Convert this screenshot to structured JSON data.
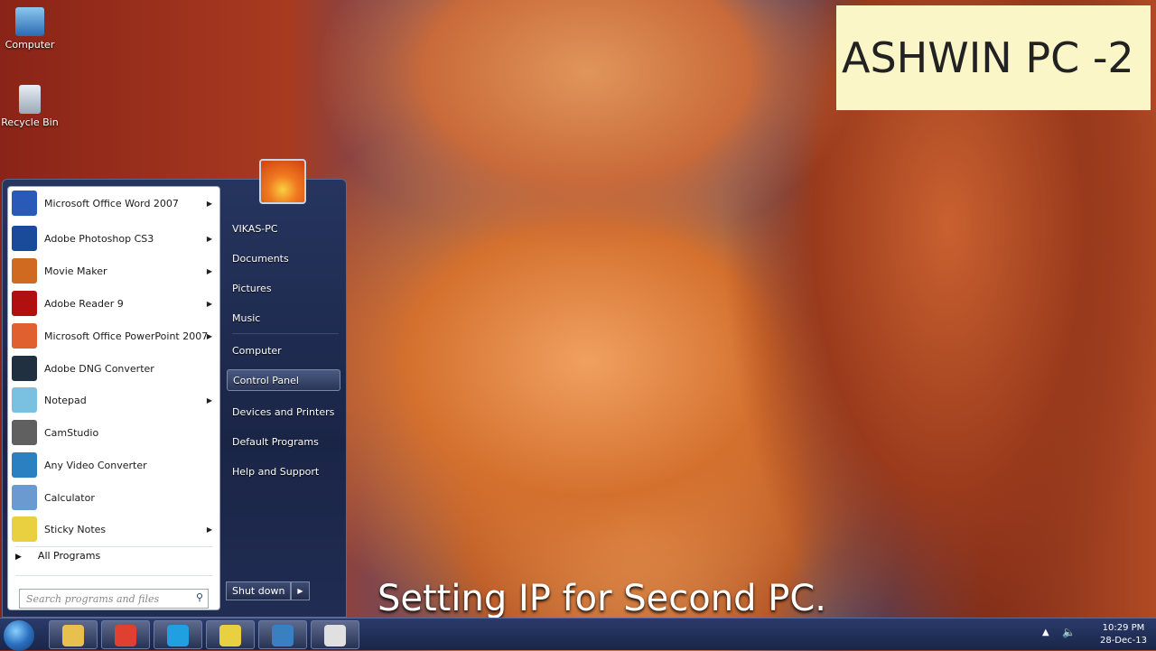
{
  "desktop": {
    "icons": [
      {
        "label": "Computer"
      },
      {
        "label": "Recycle Bin"
      }
    ]
  },
  "banner": "ASHWIN PC -2",
  "caption": "Setting IP for Second PC.",
  "start_menu": {
    "programs": [
      {
        "label": "Microsoft Office Word 2007",
        "submenu": true,
        "color": "#2a5ab8"
      },
      {
        "label": "Adobe Photoshop CS3",
        "submenu": true,
        "color": "#1a4a9a"
      },
      {
        "label": "Movie Maker",
        "submenu": true,
        "color": "#d06a20"
      },
      {
        "label": "Adobe Reader 9",
        "submenu": true,
        "color": "#b01010"
      },
      {
        "label": "Microsoft Office PowerPoint 2007",
        "submenu": true,
        "color": "#e06030"
      },
      {
        "label": "Adobe DNG Converter",
        "submenu": false,
        "color": "#203040"
      },
      {
        "label": "Notepad",
        "submenu": true,
        "color": "#7ac0e0"
      },
      {
        "label": "CamStudio",
        "submenu": false,
        "color": "#606060"
      },
      {
        "label": "Any Video Converter",
        "submenu": false,
        "color": "#2a80c0"
      },
      {
        "label": "Calculator",
        "submenu": false,
        "color": "#6a9ad0"
      },
      {
        "label": "Sticky Notes",
        "submenu": true,
        "color": "#e8d040"
      }
    ],
    "all_programs": "All Programs",
    "search_placeholder": "Search programs and files",
    "right_items": [
      "VIKAS-PC",
      "Documents",
      "Pictures",
      "Music",
      "Computer",
      "Control Panel",
      "Devices and Printers",
      "Default Programs",
      "Help and Support"
    ],
    "highlighted": "Control Panel",
    "shutdown": "Shut down"
  },
  "taskbar": {
    "apps": [
      "Windows Explorer",
      "Google Chrome",
      "Skype",
      "Files",
      "Control Panel",
      "CamStudio"
    ],
    "time": "10:29 PM",
    "date": "28-Dec-13"
  }
}
